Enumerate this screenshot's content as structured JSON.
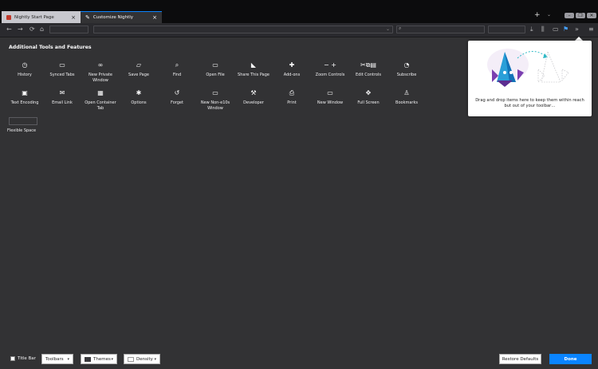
{
  "tabs": [
    {
      "label": "Nightly Start Page",
      "active": false
    },
    {
      "label": "Customize Nightly",
      "active": true
    }
  ],
  "tabstrip": {
    "new_tab_icon": "+",
    "list_tabs_icon": "⌄"
  },
  "window_controls": {
    "minimize": "–",
    "restore": "❐",
    "close": "✕"
  },
  "navbar": {
    "back_icon": "←",
    "forward_icon": "→",
    "reload_icon": "⟳",
    "home_icon": "⌂",
    "url_dropdown_icon": "⌄",
    "search_icon": "⌕",
    "right_icons": [
      "⤓",
      "⫼",
      "▭",
      "⚑",
      "»",
      "≡"
    ]
  },
  "palette": {
    "title": "Additional Tools and Features",
    "rows": [
      [
        {
          "label": "History",
          "icon": "◷"
        },
        {
          "label": "Synced Tabs",
          "icon": "▭"
        },
        {
          "label": "New Private\nWindow",
          "icon": "∞"
        },
        {
          "label": "Save Page",
          "icon": "▱"
        },
        {
          "label": "Find",
          "icon": "⌕"
        },
        {
          "label": "Open File",
          "icon": "▭"
        },
        {
          "label": "Share This Page",
          "icon": "◣"
        },
        {
          "label": "Add-ons",
          "icon": "✚"
        },
        {
          "label": "Zoom Controls",
          "icon": "− +"
        },
        {
          "label": "Edit Controls",
          "icon": "✂⧉▤"
        },
        {
          "label": "Subscribe",
          "icon": "◔"
        }
      ],
      [
        {
          "label": "Text Encoding",
          "icon": "▣"
        },
        {
          "label": "Email Link",
          "icon": "✉"
        },
        {
          "label": "Open Container\nTab",
          "icon": "▦"
        },
        {
          "label": "Options",
          "icon": "✱"
        },
        {
          "label": "Forget",
          "icon": "↺"
        },
        {
          "label": "New Non-e10s\nWindow",
          "icon": "▭"
        },
        {
          "label": "Developer",
          "icon": "⚒"
        },
        {
          "label": "Print",
          "icon": "⎙"
        },
        {
          "label": "New Window",
          "icon": "▭"
        },
        {
          "label": "Full Screen",
          "icon": "✥"
        },
        {
          "label": "Bookmarks",
          "icon": "♙"
        }
      ]
    ],
    "flexible_space_label": "Flexible Space"
  },
  "overflow_panel": {
    "text": "Drag and drop items here to keep them within reach but out of your toolbar…"
  },
  "bottom": {
    "title_bar_label": "Title Bar",
    "toolbars_label": "Toolbars",
    "themes_label": "Themes",
    "density_label": "Density",
    "dropdown_icon": "▾",
    "restore_label": "Restore Defaults",
    "done_label": "Done"
  },
  "colors": {
    "accent": "#0a84ff",
    "background": "#323234",
    "panel": "#ffffff"
  }
}
